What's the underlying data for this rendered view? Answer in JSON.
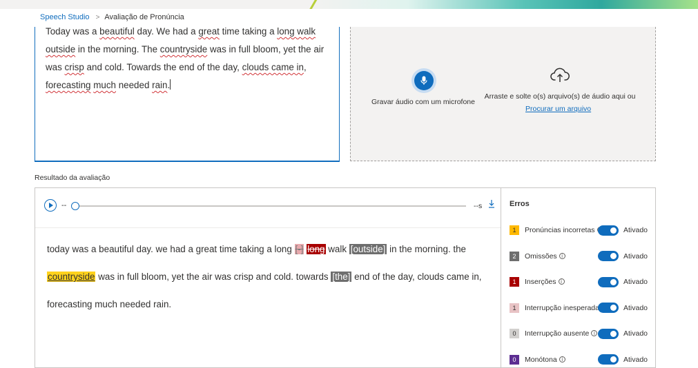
{
  "breadcrumb": {
    "root": "Speech Studio",
    "separator": ">",
    "current": "Avaliação de Pronúncia"
  },
  "reference_text": {
    "segments": [
      {
        "t": "Today was a ",
        "sq": false
      },
      {
        "t": "beautiful",
        "sq": true
      },
      {
        "t": " day. We had a ",
        "sq": false
      },
      {
        "t": "great",
        "sq": true
      },
      {
        "t": " time taking a ",
        "sq": false
      },
      {
        "t": "long walk",
        "sq": true
      },
      {
        "t": " ",
        "sq": false
      },
      {
        "t": "outside",
        "sq": true
      },
      {
        "t": " in the morning. The ",
        "sq": false
      },
      {
        "t": "countryside",
        "sq": true
      },
      {
        "t": " was in full bloom, yet the air was ",
        "sq": false
      },
      {
        "t": "crisp",
        "sq": true
      },
      {
        "t": " and cold. Towards the end of the day, ",
        "sq": false
      },
      {
        "t": "clouds came in",
        "sq": true
      },
      {
        "t": ", ",
        "sq": false
      },
      {
        "t": "forecasting",
        "sq": true
      },
      {
        "t": " ",
        "sq": false
      },
      {
        "t": "much",
        "sq": true
      },
      {
        "t": " needed ",
        "sq": false
      },
      {
        "t": "rain",
        "sq": true
      },
      {
        "t": ".",
        "sq": false
      }
    ]
  },
  "upload": {
    "mic_label": "Gravar áudio com um microfone",
    "drop_label": "Arraste e solte o(s) arquivo(s) de áudio aqui ou",
    "browse_link": "Procurar um arquivo",
    "mic_icon": "microphone-icon",
    "cloud_icon": "cloud-upload-icon"
  },
  "result": {
    "section_label": "Resultado da avaliação",
    "player": {
      "time_start": "--",
      "time_end": "--s",
      "progress": 0
    },
    "tokens": [
      {
        "t": "today was a beautiful day. we had a great time taking a long ",
        "k": "plain"
      },
      {
        "t": "[-]",
        "k": "omit"
      },
      {
        "t": " ",
        "k": "plain"
      },
      {
        "t": "long",
        "k": "insert"
      },
      {
        "t": " walk ",
        "k": "plain"
      },
      {
        "t": "[outside]",
        "k": "brk"
      },
      {
        "t": " in the morning. the ",
        "k": "plain"
      },
      {
        "t": "countryside",
        "k": "mis"
      },
      {
        "t": " was in full bloom, yet the air was crisp and cold. towards ",
        "k": "plain"
      },
      {
        "t": "[the]",
        "k": "brk"
      },
      {
        "t": " end of the day, clouds came in, forecasting much needed rain.",
        "k": "plain"
      }
    ],
    "errors": {
      "title": "Erros",
      "items": [
        {
          "count": "1",
          "label": "Pronúncias incorretas",
          "state": "Ativado",
          "color": "#ffb900",
          "text_color": "#323130"
        },
        {
          "count": "2",
          "label": "Omissões",
          "state": "Ativado",
          "color": "#6e6e6e",
          "text_color": "#ffffff"
        },
        {
          "count": "1",
          "label": "Inserções",
          "state": "Ativado",
          "color": "#a80000",
          "text_color": "#ffffff"
        },
        {
          "count": "1",
          "label": "Interrupção inesperada",
          "state": "Ativado",
          "color": "#e8c3c5",
          "text_color": "#323130"
        },
        {
          "count": "0",
          "label": "Interrupção ausente",
          "state": "Ativado",
          "color": "#d2d0ce",
          "text_color": "#323130"
        },
        {
          "count": "0",
          "label": "Monótona",
          "state": "Ativado",
          "color": "#5c2d91",
          "text_color": "#ffffff"
        }
      ]
    }
  }
}
